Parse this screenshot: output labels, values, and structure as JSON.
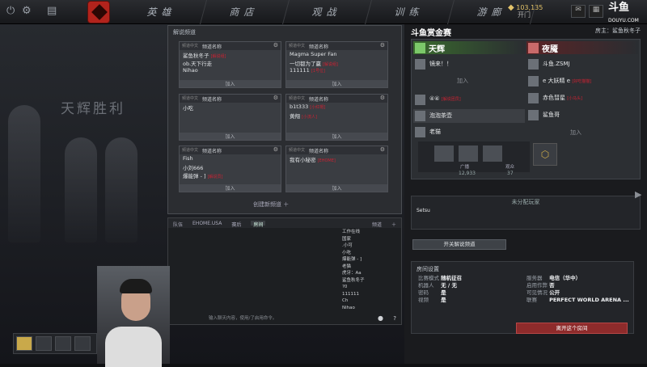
{
  "topbar": {
    "nav": [
      "英雄",
      "商店",
      "观战",
      "训练",
      "游廊"
    ],
    "gold": "103,135",
    "gold_sub": "开门",
    "douyu": "斗鱼",
    "douyu_sub": "DOUYU.COM"
  },
  "bg": {
    "victory": "天辉胜利"
  },
  "lobby": {
    "title": "解说频道",
    "col_a": "频道中文",
    "col_b": "频道名称",
    "join": "加入",
    "create": "创建新频道 ＋",
    "cards": [
      {
        "rows": [
          "鲨鱼秋冬子",
          "ob.天下行走",
          "Nihao"
        ],
        "tags": [
          "[解说组]",
          "",
          ""
        ]
      },
      {
        "rows": [
          "Magma Super Fan",
          "一切都为了赢",
          "111111"
        ],
        "tags": [
          "",
          "[解说组]",
          "[1号位]"
        ]
      },
      {
        "rows": [
          "小吃"
        ],
        "tags": [
          ""
        ]
      },
      {
        "rows": [
          "b1t333",
          "黄翔"
        ],
        "tags": [
          "[小红帽]",
          "[小流人]"
        ]
      },
      {
        "rows": [
          "Fish",
          "小刘666",
          "爆能弹 - ]"
        ],
        "tags": [
          "",
          "",
          "[解说员]"
        ]
      },
      {
        "rows": [
          "我有小秘密"
        ],
        "tags": [
          "[EHOME]"
        ]
      }
    ]
  },
  "chat": {
    "tabs": [
      "队伍",
      "EHOME.USA",
      "赛后",
      "房间"
    ],
    "tab_right": "频道",
    "input": "输入聊天内容，使用/了启用命令。",
    "players": [
      "工作在线",
      "国家",
      ".小可",
      "小吃",
      "爆能弹 - ]",
      "老猫",
      "虎牙：Aa",
      "鲨鱼秋冬子",
      "?0",
      "111111",
      "Ch",
      "Nihao"
    ]
  },
  "right": {
    "title": "斗鱼赏金赛",
    "owner": "房主：鲨鱼秋冬子",
    "radiant": {
      "name": "天辉",
      "players": [
        "镜来！！",
        "④④",
        "泡泡茶壶",
        "老猫"
      ],
      "tags": [
        "",
        "[解说团员]",
        "",
        ""
      ],
      "add": "加入"
    },
    "dire": {
      "name": "夜魇",
      "players": [
        "斗鱼.ZSMJ",
        "e 大妖精 e",
        "赤色彗星",
        "鲨鱼哥"
      ],
      "tags": [
        "",
        "[好吃猫猫]",
        "[小马头]",
        ""
      ],
      "add": "加入"
    },
    "spect_counts": [
      "12,933",
      "37"
    ],
    "spect_labels": [
      "广播",
      "观众"
    ],
    "unassigned": {
      "title": "未分配玩家",
      "player": "Setsu"
    },
    "bc_button": "开关解说频道",
    "settings": {
      "title": "房间设置",
      "left": [
        [
          "比赛模式",
          "随机征召"
        ],
        [
          "机器人",
          "无 / 无"
        ],
        [
          "密码",
          "是"
        ],
        [
          "视频",
          "是"
        ]
      ],
      "right": [
        [
          "服务器",
          "电信（华中）"
        ],
        [
          "启用作弊",
          "否"
        ],
        [
          "可见情况",
          "公开"
        ],
        [
          "联赛",
          "PERFECT WORLD ARENA ..."
        ]
      ]
    },
    "leave": "离开这个房间"
  }
}
